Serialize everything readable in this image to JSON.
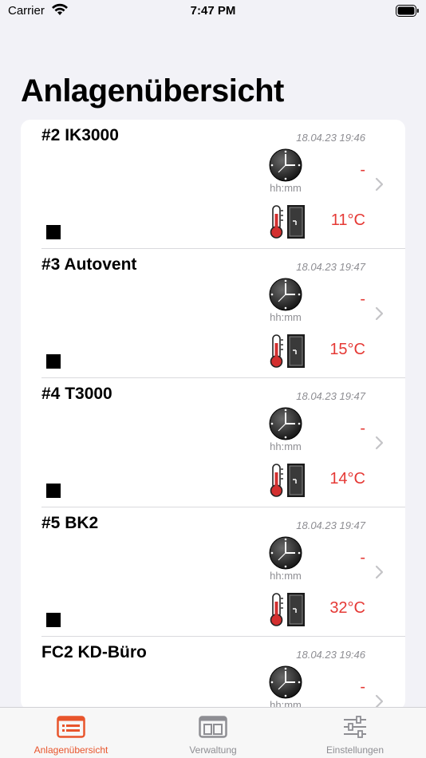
{
  "status_bar": {
    "carrier": "Carrier",
    "time": "7:47 PM"
  },
  "page": {
    "title": "Anlagenübersicht"
  },
  "items": [
    {
      "name": "#2 IK3000",
      "date": "18.04.23 19:46",
      "time_value": "-",
      "time_unit": "hh:mm",
      "temperature": "11°C"
    },
    {
      "name": "#3 Autovent",
      "date": "18.04.23 19:47",
      "time_value": "-",
      "time_unit": "hh:mm",
      "temperature": "15°C"
    },
    {
      "name": "#4 T3000",
      "date": "18.04.23 19:47",
      "time_value": "-",
      "time_unit": "hh:mm",
      "temperature": "14°C"
    },
    {
      "name": "#5 BK2",
      "date": "18.04.23 19:47",
      "time_value": "-",
      "time_unit": "hh:mm",
      "temperature": "32°C"
    },
    {
      "name": "FC2 KD-Büro",
      "date": "18.04.23 19:46",
      "time_value": "-",
      "time_unit": "hh:mm",
      "temperature": ""
    }
  ],
  "tabs": [
    {
      "label": "Anlagenübersicht",
      "icon": "list-card-icon",
      "active": true
    },
    {
      "label": "Verwaltung",
      "icon": "panel-layout-icon",
      "active": false
    },
    {
      "label": "Einstellungen",
      "icon": "sliders-icon",
      "active": false
    }
  ],
  "colors": {
    "accent": "#e8552c",
    "alert_red": "#e53935",
    "secondary_gray": "#8e8e93",
    "background": "#f2f2f7"
  }
}
